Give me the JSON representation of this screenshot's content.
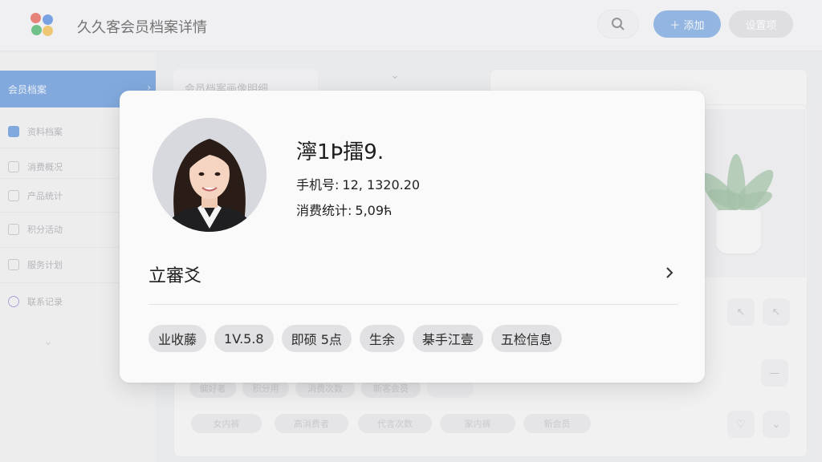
{
  "app": {
    "title": "久久客会员档案详情",
    "primary_button": "＋ 添加",
    "secondary_button": "设置项"
  },
  "sidebar": {
    "active": "会员档案",
    "items": [
      "资料档案",
      "消费概况",
      "产品统计",
      "积分活动",
      "服务计划",
      "联系记录"
    ]
  },
  "background": {
    "tab_label": "会员档案画像明细",
    "pills_row1": [
      "偏好者",
      "积分用",
      "消费次数",
      "新客会员"
    ],
    "pills_row2": [
      "女内裤",
      "高消费者",
      "代言次数",
      "家内裤",
      "新会员"
    ]
  },
  "member": {
    "name": "濘1Ϸ擂9.",
    "phone_label": "手机号:",
    "phone_value": "12, 1320.20",
    "spend_label": "消费统计:",
    "spend_value": "5,09ћ",
    "section_title": "立審爻",
    "tags": [
      "业收藤",
      "1V.5.8",
      "即硕 5点",
      "生余",
      "棊手江壹",
      "五检信息"
    ]
  },
  "colors": {
    "accent": "#4a86d4",
    "modal_bg": "#fafafa",
    "tag_bg": "#e1e1e3"
  },
  "icons": [
    "app-logo-icon",
    "search-icon",
    "plus-icon",
    "chevron-right-icon",
    "chevron-down-icon",
    "checkbox-icon"
  ]
}
